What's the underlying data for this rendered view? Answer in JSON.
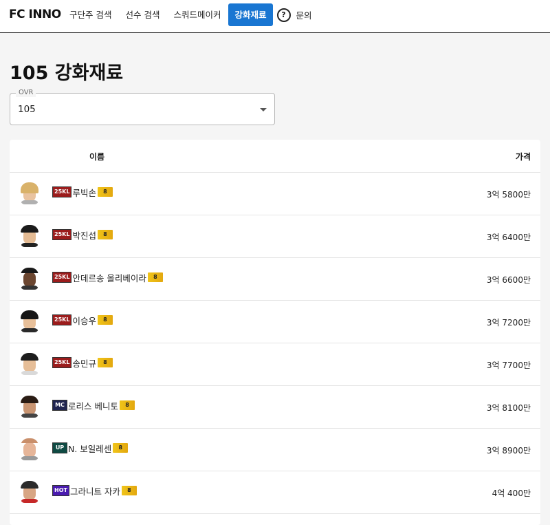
{
  "brand": "FC INNO",
  "nav": {
    "items": [
      "구단주 검색",
      "선수 검색",
      "스쿼드메이커",
      "강화재료"
    ],
    "active_index": 3,
    "help_icon": "question-circle-icon",
    "help_label": "문의"
  },
  "page_title": "105 강화재료",
  "ovr": {
    "label": "OVR",
    "value": "105"
  },
  "table": {
    "headers": {
      "name": "이름",
      "price": "가격"
    },
    "rows": [
      {
        "season": "25KL",
        "name": "루빅손",
        "grade": "8",
        "price": "3억 5800만"
      },
      {
        "season": "25KL",
        "name": "박진섭",
        "grade": "8",
        "price": "3억 6400만"
      },
      {
        "season": "25KL",
        "name": "안데르송 올리베이라",
        "grade": "8",
        "price": "3억 6600만"
      },
      {
        "season": "25KL",
        "name": "이승우",
        "grade": "8",
        "price": "3억 7200만"
      },
      {
        "season": "25KL",
        "name": "송민규",
        "grade": "8",
        "price": "3억 7700만"
      },
      {
        "season": "MC",
        "name": "로리스 베니토",
        "grade": "8",
        "price": "3억 8100만"
      },
      {
        "season": "UP",
        "name": "N. 보일레센",
        "grade": "8",
        "price": "3억 8900만"
      },
      {
        "season": "HOT",
        "name": "그라니트 자카",
        "grade": "8",
        "price": "4억 400만"
      }
    ]
  },
  "colors": {
    "accent": "#1976d2",
    "season_25KL": "#9b1c1c",
    "season_MC": "#1f2450",
    "season_UP": "#0f4a43",
    "season_HOT": "#4a1bb0",
    "grade_gold": "#f0c419"
  }
}
